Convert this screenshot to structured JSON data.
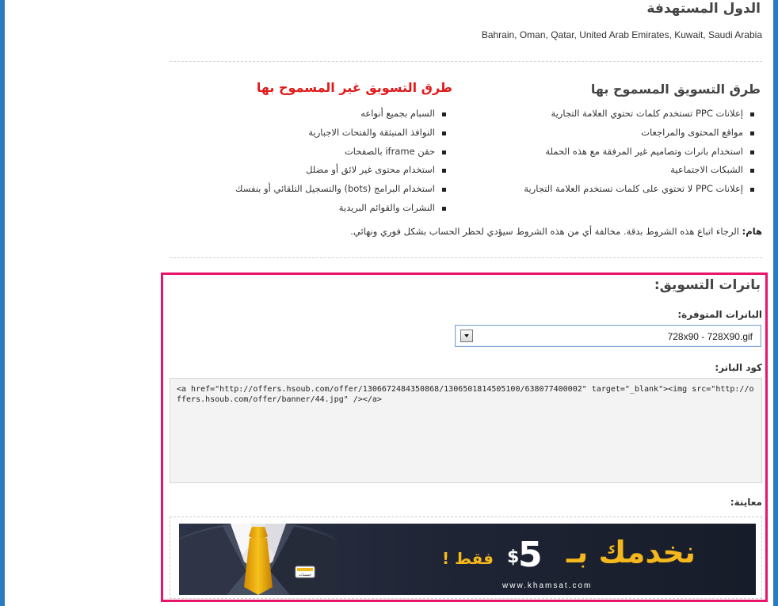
{
  "targeting": {
    "title": "الدول المستهدفة",
    "countries": "Bahrain, Oman, Qatar, United Arab Emirates, Kuwait, Saudi Arabia"
  },
  "marketing": {
    "allowed": {
      "title": "طرق التسويق المسموح بها",
      "items": [
        "إعلانات PPC تستخدم كلمات تحتوي العلامة التجارية",
        "مواقع المحتوى والمراجعات",
        "استخدام بانرات وتصاميم غير المرفقة مع هذه الحملة",
        "الشبكات الاجتماعية",
        "إعلانات PPC لا تحتوي على كلمات تستخدم العلامة التجارية"
      ]
    },
    "denied": {
      "title": "طرق التسويق غير المسموح بها",
      "items": [
        "السبام بجميع أنواعه",
        "النوافذ المنبثقة والفتحات الاجبارية",
        "حقن iframe بالصفحات",
        "استخدام محتوى غير لائق أو مضلل",
        "استخدام البرامج (bots) والتسجيل التلقائي أو بنفسك",
        "النشرات والقوائم البريدية"
      ]
    },
    "note_label": "هام:",
    "note_text": "الرجاء اتباع هذه الشروط بدقة. مخالفة أي من هذه الشروط سيؤدي لحظر الحساب بشكل فوري ونهائي."
  },
  "banners": {
    "title": "بانرات التسويق:",
    "available_label": "البانرات المتوفرة:",
    "selected": "728x90 - 728X90.gif",
    "code_label": "كود البانر:",
    "code": "<a href=\"http://offers.hsoub.com/offer/1306672484350868/1306501814505100/638077400002\" target=\"_blank\"><img src=\"http://offers.hsoub.com/offer/banner/44.jpg\" /></a>",
    "preview_label": "معاينة:",
    "ad": {
      "headline": "نخدمك بـ",
      "price_symbol": "$",
      "price": "5",
      "only": "فقط !",
      "url": "www.khamsat.com",
      "badge": "خمسات"
    }
  },
  "colors": {
    "accent_border": "#e8156a",
    "denied_title": "#e01b1b",
    "frame": "#2a7bbf",
    "ad_gold": "#f5b81c"
  }
}
